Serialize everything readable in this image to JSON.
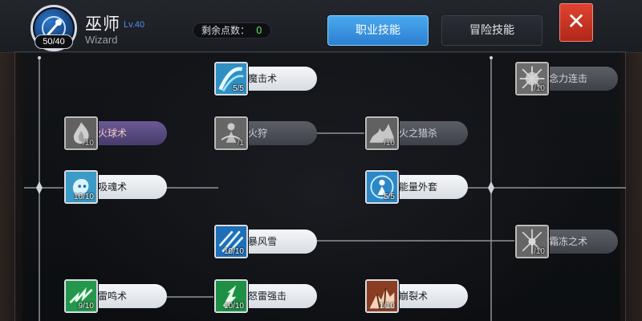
{
  "header": {
    "avatar_badge": "50/40",
    "class_name": "巫师",
    "class_level": "Lv.40",
    "class_name_en": "Wizard",
    "points_label": "剩余点数：",
    "points_value": "0",
    "tabs": [
      {
        "label": "职业技能",
        "active": true
      },
      {
        "label": "冒险技能",
        "active": false
      }
    ],
    "close_glyph": "✕"
  },
  "skills": [
    {
      "id": "magic-strike",
      "name": "魔击术",
      "level": "5/5",
      "state": "learned",
      "icon": "wave-icon"
    },
    {
      "id": "mind-combo",
      "name": "念力连击",
      "level": "/10",
      "state": "locked",
      "icon": "burst-icon"
    },
    {
      "id": "fireball",
      "name": "火球术",
      "level": "/10",
      "state": "fire",
      "icon": "flame-icon"
    },
    {
      "id": "fire-hunt",
      "name": "火狩",
      "level": "/1",
      "state": "locked",
      "icon": "fire-figure-icon"
    },
    {
      "id": "fire-slaughter",
      "name": "火之猎杀",
      "level": "/10",
      "state": "locked",
      "icon": "fire-wave-icon"
    },
    {
      "id": "soul-drain",
      "name": "吸魂术",
      "level": "10/10",
      "state": "learned",
      "icon": "spirit-icon"
    },
    {
      "id": "energy-coat",
      "name": "能量外套",
      "level": "5/5",
      "state": "learned",
      "icon": "shield-figure-icon"
    },
    {
      "id": "blizzard",
      "name": "暴风雪",
      "level": "10/10",
      "state": "learned",
      "icon": "ice-shard-icon"
    },
    {
      "id": "frost-art",
      "name": "霜冻之术",
      "level": "/10",
      "state": "locked",
      "icon": "frost-icon"
    },
    {
      "id": "thunder-roar",
      "name": "雷鸣术",
      "level": "9/10",
      "state": "learned",
      "icon": "lightning-icon"
    },
    {
      "id": "thunder-strike",
      "name": "怒雷强击",
      "level": "10/10",
      "state": "learned",
      "icon": "lightning-strike-icon"
    },
    {
      "id": "crack-art",
      "name": "崩裂术",
      "level": "1/10",
      "state": "learned",
      "icon": "crack-icon"
    }
  ],
  "colors": {
    "accent_blue": "#3b96e3",
    "close_red": "#d03a27",
    "points_green": "#5bd66b",
    "level_blue": "#4d93e6"
  }
}
